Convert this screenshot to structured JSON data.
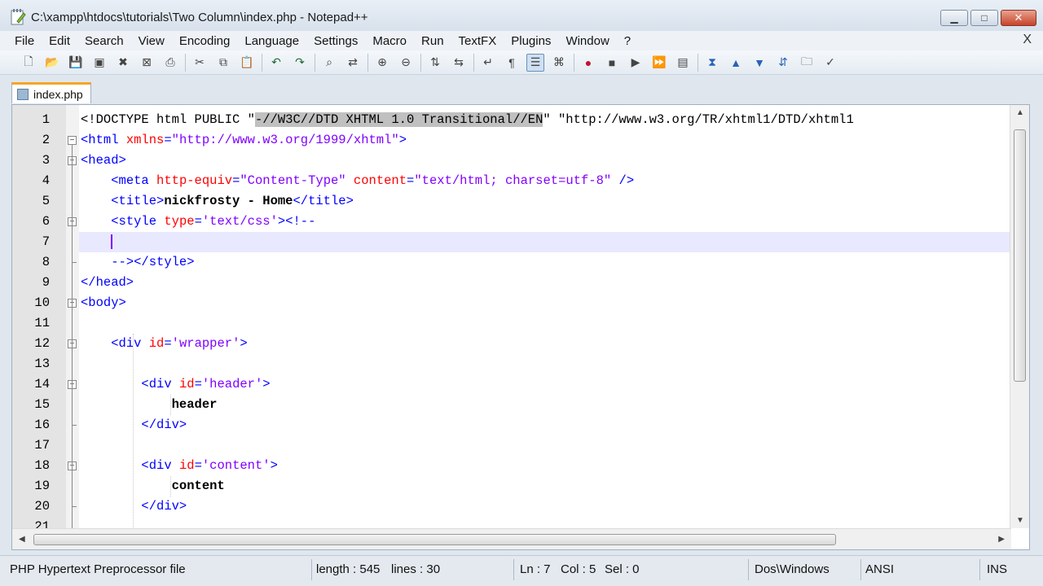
{
  "window": {
    "title": "C:\\xampp\\htdocs\\tutorials\\Two Column\\index.php - Notepad++",
    "minimize": "▁",
    "maximize": "□",
    "close": "✕"
  },
  "menu": {
    "items": [
      "File",
      "Edit",
      "Search",
      "View",
      "Encoding",
      "Language",
      "Settings",
      "Macro",
      "Run",
      "TextFX",
      "Plugins",
      "Window",
      "?"
    ],
    "close_doc": "X"
  },
  "toolbar": {
    "buttons": [
      "new-file-icon",
      "open-file-icon",
      "save-icon",
      "save-all-icon",
      "close-icon",
      "close-all-icon",
      "print-icon",
      "cut-icon",
      "copy-icon",
      "paste-icon",
      "undo-icon",
      "redo-icon",
      "find-icon",
      "replace-icon",
      "zoom-in-icon",
      "zoom-out-icon",
      "sync-v-icon",
      "sync-h-icon",
      "word-wrap-icon",
      "show-all-chars-icon",
      "indent-guide-icon",
      "user-lang-icon",
      "record-macro-icon",
      "stop-macro-icon",
      "play-macro-icon",
      "run-macro-multiple-icon",
      "save-macro-icon",
      "tfx-collapse-icon",
      "tfx-up-icon",
      "tfx-down-icon",
      "tfx-sort-icon",
      "tfx-folder-icon",
      "spellcheck-icon"
    ]
  },
  "tab": {
    "label": "index.php"
  },
  "editor": {
    "lines": [
      {
        "n": "1",
        "html": "<span class=\"doctype\">&lt;!DOCTYPE html PUBLIC \"<span class=\"sel\">-//W3C//DTD XHTML 1.0 Transitional//EN</span>\" \"http://www.w3.org/TR/xhtml1/DTD/xhtml1</span>"
      },
      {
        "n": "2",
        "html": "<span class=\"tag\">&lt;html</span> <span class=\"attr\">xmlns</span><span class=\"tag\">=</span><span class=\"val\">\"http://www.w3.org/1999/xhtml\"</span><span class=\"tag\">&gt;</span>"
      },
      {
        "n": "3",
        "html": "<span class=\"tag\">&lt;head&gt;</span>"
      },
      {
        "n": "4",
        "html": "    <span class=\"tag\">&lt;meta</span> <span class=\"attr\">http-equiv</span><span class=\"tag\">=</span><span class=\"val\">\"Content-Type\"</span> <span class=\"attr\">content</span><span class=\"tag\">=</span><span class=\"val\">\"text/html; charset=utf-8\"</span> <span class=\"tag\">/&gt;</span>"
      },
      {
        "n": "5",
        "html": "    <span class=\"tag\">&lt;title&gt;</span><span class=\"txt\">nickfrosty - Home</span><span class=\"tag\">&lt;/title&gt;</span>"
      },
      {
        "n": "6",
        "html": "    <span class=\"tag\">&lt;style</span> <span class=\"attr\">type</span><span class=\"tag\">=</span><span class=\"val\">'text/css'</span><span class=\"tag\">&gt;</span><span class=\"tag\">&lt;!--</span>"
      },
      {
        "n": "7",
        "html": "    <span class=\"caret\"></span>"
      },
      {
        "n": "8",
        "html": "    <span class=\"tag\">--&gt;&lt;/style&gt;</span>"
      },
      {
        "n": "9",
        "html": "<span class=\"tag\">&lt;/head&gt;</span>"
      },
      {
        "n": "10",
        "html": "<span class=\"tag\">&lt;body&gt;</span>"
      },
      {
        "n": "11",
        "html": ""
      },
      {
        "n": "12",
        "html": "    <span class=\"tag\">&lt;div</span> <span class=\"attr\">id</span><span class=\"tag\">=</span><span class=\"val\">'wrapper'</span><span class=\"tag\">&gt;</span>"
      },
      {
        "n": "13",
        "html": ""
      },
      {
        "n": "14",
        "html": "        <span class=\"tag\">&lt;div</span> <span class=\"attr\">id</span><span class=\"tag\">=</span><span class=\"val\">'header'</span><span class=\"tag\">&gt;</span>"
      },
      {
        "n": "15",
        "html": "            <span class=\"txt\">header</span>"
      },
      {
        "n": "16",
        "html": "        <span class=\"tag\">&lt;/div&gt;</span>"
      },
      {
        "n": "17",
        "html": ""
      },
      {
        "n": "18",
        "html": "        <span class=\"tag\">&lt;div</span> <span class=\"attr\">id</span><span class=\"tag\">=</span><span class=\"val\">'content'</span><span class=\"tag\">&gt;</span>"
      },
      {
        "n": "19",
        "html": "            <span class=\"txt\">content</span>"
      },
      {
        "n": "20",
        "html": "        <span class=\"tag\">&lt;/div&gt;</span>"
      },
      {
        "n": "21",
        "html": ""
      }
    ],
    "current_line": 7
  },
  "status": {
    "file_type": "PHP Hypertext Preprocessor file",
    "length": "length : 545",
    "lines": "lines : 30",
    "ln": "Ln : 7",
    "col": "Col : 5",
    "sel": "Sel : 0",
    "eol": "Dos\\Windows",
    "encoding": "ANSI",
    "mode": "INS"
  }
}
